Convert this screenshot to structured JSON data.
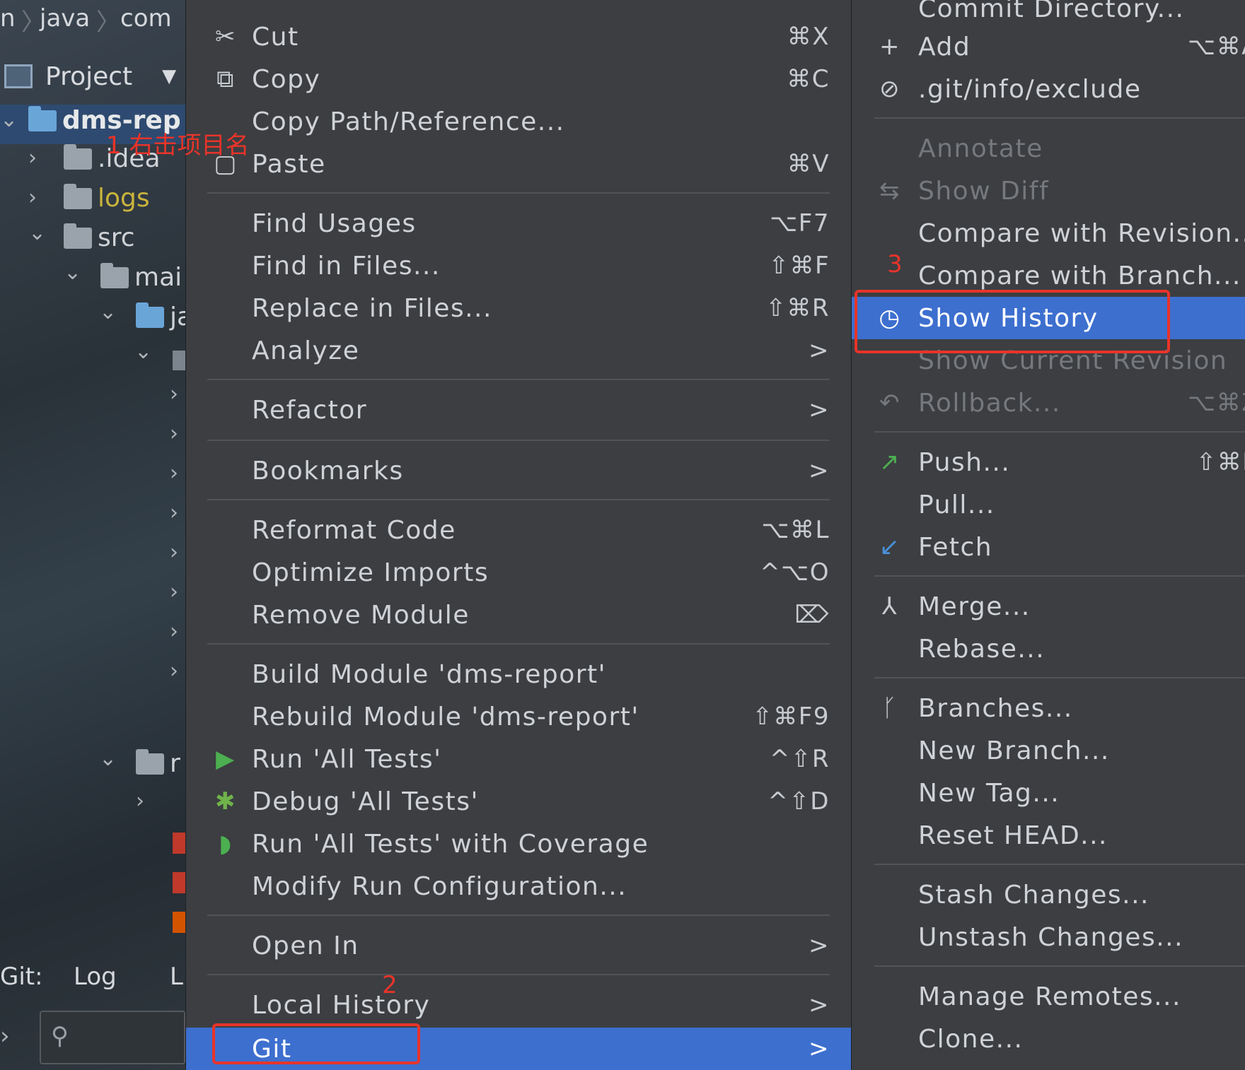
{
  "left_panel": {
    "breadcrumb": [
      "n",
      "java",
      "com"
    ],
    "project_label": "Project",
    "tree": [
      {
        "label": "dms-rep",
        "bold": true
      },
      {
        "label": ".idea"
      },
      {
        "label": "logs"
      },
      {
        "label": "src"
      },
      {
        "label": "mai"
      },
      {
        "label": "ja"
      },
      {
        "label": "r"
      }
    ],
    "bottom_tabs": [
      "Git:",
      "Log",
      "L"
    ]
  },
  "annotations": {
    "step1": "1 右击项目名",
    "step2": "2",
    "step3": "3"
  },
  "context_menu": {
    "items": [
      {
        "label": "Cut",
        "shortcut": "⌘X",
        "icon": "scissors-icon"
      },
      {
        "label": "Copy",
        "shortcut": "⌘C",
        "icon": "copy-icon"
      },
      {
        "label": "Copy Path/Reference...",
        "shortcut": ""
      },
      {
        "label": "Paste",
        "shortcut": "⌘V",
        "icon": "paste-icon"
      },
      {
        "label": "Find Usages",
        "shortcut": "⌥F7"
      },
      {
        "label": "Find in Files...",
        "shortcut": "⇧⌘F"
      },
      {
        "label": "Replace in Files...",
        "shortcut": "⇧⌘R"
      },
      {
        "label": "Analyze",
        "shortcut": ">"
      },
      {
        "label": "Refactor",
        "shortcut": ">"
      },
      {
        "label": "Bookmarks",
        "shortcut": ">"
      },
      {
        "label": "Reformat Code",
        "shortcut": "⌥⌘L"
      },
      {
        "label": "Optimize Imports",
        "shortcut": "^⌥O"
      },
      {
        "label": "Remove Module",
        "shortcut": "⌦"
      },
      {
        "label": "Build Module 'dms-report'",
        "shortcut": ""
      },
      {
        "label": "Rebuild Module 'dms-report'",
        "shortcut": "⇧⌘F9"
      },
      {
        "label": "Run 'All Tests'",
        "shortcut": "^⇧R",
        "icon": "run-icon"
      },
      {
        "label": "Debug 'All Tests'",
        "shortcut": "^⇧D",
        "icon": "debug-icon"
      },
      {
        "label": "Run 'All Tests' with Coverage",
        "shortcut": "",
        "icon": "coverage-icon"
      },
      {
        "label": "Modify Run Configuration...",
        "shortcut": ""
      },
      {
        "label": "Open In",
        "shortcut": ">"
      },
      {
        "label": "Local History",
        "shortcut": ">"
      },
      {
        "label": "Git",
        "shortcut": ">",
        "selected": true
      }
    ]
  },
  "git_submenu": {
    "items": [
      {
        "label": "Commit Directory...",
        "shortcut": ""
      },
      {
        "label": "Add",
        "shortcut": "⌥⌘A",
        "icon": "plus-icon"
      },
      {
        "label": ".git/info/exclude",
        "shortcut": "",
        "icon": "git-exclude-icon"
      },
      {
        "label": "Annotate",
        "shortcut": "",
        "disabled": true
      },
      {
        "label": "Show Diff",
        "shortcut": "",
        "disabled": true,
        "icon": "diff-icon"
      },
      {
        "label": "Compare with Revision...",
        "shortcut": ""
      },
      {
        "label": "Compare with Branch...",
        "shortcut": ""
      },
      {
        "label": "Show History",
        "shortcut": "",
        "selected": true,
        "icon": "clock-icon"
      },
      {
        "label": "Show Current Revision",
        "shortcut": "",
        "disabled": true
      },
      {
        "label": "Rollback...",
        "shortcut": "⌥⌘Z",
        "disabled": true,
        "icon": "rollback-icon"
      },
      {
        "label": "Push...",
        "shortcut": "⇧⌘K",
        "icon": "push-icon"
      },
      {
        "label": "Pull...",
        "shortcut": ""
      },
      {
        "label": "Fetch",
        "shortcut": "",
        "icon": "fetch-icon"
      },
      {
        "label": "Merge...",
        "shortcut": "",
        "icon": "merge-icon"
      },
      {
        "label": "Rebase...",
        "shortcut": ""
      },
      {
        "label": "Branches...",
        "shortcut": "",
        "icon": "branch-icon"
      },
      {
        "label": "New Branch...",
        "shortcut": ""
      },
      {
        "label": "New Tag...",
        "shortcut": ""
      },
      {
        "label": "Reset HEAD...",
        "shortcut": ""
      },
      {
        "label": "Stash Changes...",
        "shortcut": ""
      },
      {
        "label": "Unstash Changes...",
        "shortcut": ""
      },
      {
        "label": "Manage Remotes...",
        "shortcut": ""
      },
      {
        "label": "Clone...",
        "shortcut": ""
      }
    ]
  },
  "colors": {
    "menu_bg": "#3c3e41",
    "selection": "#3d6fcf",
    "annotation_red": "#e8342a",
    "run_green": "#4caf50"
  }
}
